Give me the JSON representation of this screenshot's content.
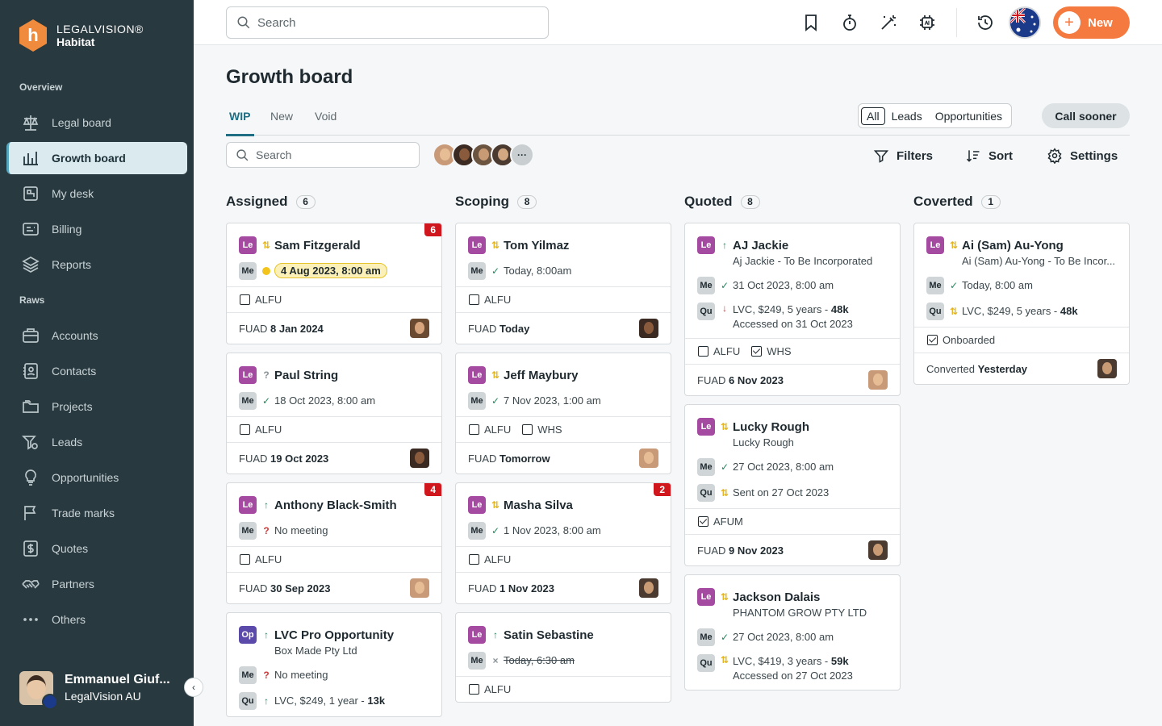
{
  "brand": {
    "line1": "LEGALVISION®",
    "line2": "Habitat",
    "logo_letter": "h"
  },
  "sidebar": {
    "overview_label": "Overview",
    "raws_label": "Raws",
    "items": [
      {
        "label": "Legal board",
        "icon": "scale-icon"
      },
      {
        "label": "Growth board",
        "icon": "chart-icon"
      },
      {
        "label": "My desk",
        "icon": "desk-icon"
      },
      {
        "label": "Billing",
        "icon": "billing-icon"
      },
      {
        "label": "Reports",
        "icon": "layers-icon"
      },
      {
        "label": "Accounts",
        "icon": "briefcase-icon"
      },
      {
        "label": "Contacts",
        "icon": "contact-icon"
      },
      {
        "label": "Projects",
        "icon": "folder-icon"
      },
      {
        "label": "Leads",
        "icon": "leads-icon"
      },
      {
        "label": "Opportunities",
        "icon": "bulb-icon"
      },
      {
        "label": "Trade marks",
        "icon": "flag-icon"
      },
      {
        "label": "Quotes",
        "icon": "dollar-icon"
      },
      {
        "label": "Partners",
        "icon": "handshake-icon"
      },
      {
        "label": "Others",
        "icon": "dots-icon"
      }
    ],
    "user_name": "Emmanuel Giuf...",
    "user_org": "LegalVision AU"
  },
  "topbar": {
    "search_placeholder": "Search",
    "new_label": "New"
  },
  "page": {
    "title": "Growth board",
    "tabs": [
      "WIP",
      "New",
      "Void"
    ],
    "segments": [
      "All",
      "Leads",
      "Opportunities"
    ],
    "call_sooner": "Call sooner",
    "board_search_placeholder": "Search",
    "more_avatars": "···",
    "tools": [
      "Filters",
      "Sort",
      "Settings"
    ]
  },
  "columns": [
    {
      "title": "Assigned",
      "count": "6",
      "cards": [
        {
          "tag": "Le",
          "status": "sw",
          "name": "Sam Fitzgerald",
          "badge": "6",
          "rows": [
            {
              "tag": "Me",
              "status": "dot",
              "pill": "4 Aug 2023, 8:00 am"
            }
          ],
          "checks": [
            {
              "label": "ALFU",
              "checked": false
            }
          ],
          "foot_label": "FUAD",
          "foot_value": "8 Jan 2024"
        },
        {
          "tag": "Le",
          "status": "qg",
          "name": "Paul String",
          "rows": [
            {
              "tag": "Me",
              "status": "ok",
              "text": "18 Oct 2023, 8:00 am"
            }
          ],
          "checks": [
            {
              "label": "ALFU",
              "checked": false
            }
          ],
          "foot_label": "FUAD",
          "foot_value": "19 Oct 2023"
        },
        {
          "tag": "Le",
          "status": "up",
          "name": "Anthony Black-Smith",
          "badge": "4",
          "rows": [
            {
              "tag": "Me",
              "status": "q",
              "text": "No meeting"
            }
          ],
          "checks": [
            {
              "label": "ALFU",
              "checked": false
            }
          ],
          "foot_label": "FUAD",
          "foot_value": "30 Sep 2023"
        },
        {
          "tag": "Op",
          "status": "up",
          "name": "LVC Pro Opportunity",
          "sub": "Box Made Pty Ltd",
          "rows": [
            {
              "tag": "Me",
              "status": "q",
              "text": "No meeting"
            },
            {
              "tag": "Qu",
              "status": "up",
              "text": "LVC, $249, 1 year - ",
              "bold": "13k"
            }
          ]
        }
      ]
    },
    {
      "title": "Scoping",
      "count": "8",
      "cards": [
        {
          "tag": "Le",
          "status": "sw",
          "name": "Tom Yilmaz",
          "rows": [
            {
              "tag": "Me",
              "status": "ok",
              "text": "Today, 8:00am"
            }
          ],
          "checks": [
            {
              "label": "ALFU",
              "checked": false
            }
          ],
          "foot_label": "FUAD",
          "foot_value": "Today"
        },
        {
          "tag": "Le",
          "status": "sw",
          "name": "Jeff Maybury",
          "rows": [
            {
              "tag": "Me",
              "status": "ok",
              "text": "7 Nov 2023, 1:00 am"
            }
          ],
          "checks": [
            {
              "label": "ALFU",
              "checked": false
            },
            {
              "label": "WHS",
              "checked": false
            }
          ],
          "foot_label": "FUAD",
          "foot_value": "Tomorrow"
        },
        {
          "tag": "Le",
          "status": "sw",
          "name": "Masha Silva",
          "badge": "2",
          "rows": [
            {
              "tag": "Me",
              "status": "ok",
              "text": "1 Nov 2023, 8:00 am"
            }
          ],
          "checks": [
            {
              "label": "ALFU",
              "checked": false
            }
          ],
          "foot_label": "FUAD",
          "foot_value": "1 Nov 2023"
        },
        {
          "tag": "Le",
          "status": "up",
          "name": "Satin Sebastine",
          "rows": [
            {
              "tag": "Me",
              "status": "x",
              "text": "Today, 6:30 am",
              "strike": true
            }
          ],
          "checks": [
            {
              "label": "ALFU",
              "checked": false
            }
          ]
        }
      ]
    },
    {
      "title": "Quoted",
      "count": "8",
      "cards": [
        {
          "tag": "Le",
          "status": "up",
          "name": "AJ Jackie",
          "sub": "Aj Jackie - To Be Incorporated",
          "rows": [
            {
              "tag": "Me",
              "status": "ok",
              "text": "31 Oct 2023, 8:00 am"
            },
            {
              "tag": "Qu",
              "status": "down",
              "text": "LVC, $249, 5 years - ",
              "bold": "48k",
              "line2": "Accessed on 31 Oct 2023"
            }
          ],
          "checks": [
            {
              "label": "ALFU",
              "checked": false
            },
            {
              "label": "WHS",
              "checked": true
            }
          ],
          "foot_label": "FUAD",
          "foot_value": "6 Nov 2023"
        },
        {
          "tag": "Le",
          "status": "sw",
          "name": "Lucky Rough",
          "sub": "Lucky Rough",
          "rows": [
            {
              "tag": "Me",
              "status": "ok",
              "text": "27 Oct 2023, 8:00 am"
            },
            {
              "tag": "Qu",
              "status": "sw",
              "text": "Sent on 27 Oct 2023"
            }
          ],
          "checks": [
            {
              "label": "AFUM",
              "checked": true
            }
          ],
          "foot_label": "FUAD",
          "foot_value": "9 Nov 2023"
        },
        {
          "tag": "Le",
          "status": "sw",
          "name": "Jackson Dalais",
          "sub": "PHANTOM GROW PTY LTD",
          "rows": [
            {
              "tag": "Me",
              "status": "ok",
              "text": "27 Oct 2023, 8:00 am"
            },
            {
              "tag": "Qu",
              "status": "sw",
              "text": "LVC, $419, 3 years - ",
              "bold": "59k",
              "line2": "Accessed on 27 Oct 2023"
            }
          ]
        }
      ]
    },
    {
      "title": "Coverted",
      "count": "1",
      "cards": [
        {
          "tag": "Le",
          "status": "sw",
          "name": "Ai (Sam) Au-Yong",
          "sub": "Ai (Sam) Au-Yong - To Be Incor...",
          "rows": [
            {
              "tag": "Me",
              "status": "ok",
              "text": "Today, 8:00 am"
            },
            {
              "tag": "Qu",
              "status": "sw",
              "text": "LVC, $249, 5 years - ",
              "bold": "48k"
            }
          ],
          "checks": [
            {
              "label": "Onboarded",
              "checked": true
            }
          ],
          "foot_label": "Converted",
          "foot_value": "Yesterday"
        }
      ]
    }
  ]
}
